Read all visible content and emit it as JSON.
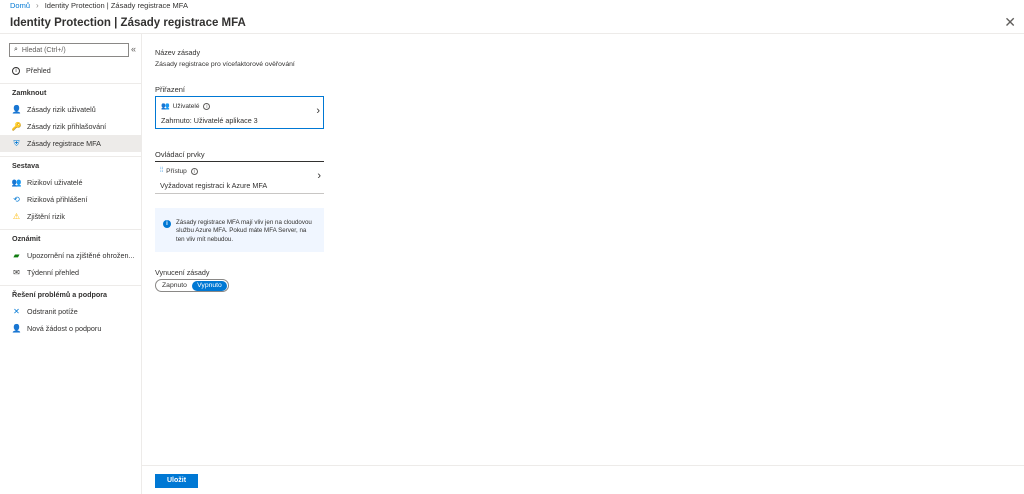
{
  "breadcrumb": {
    "home": "Domů",
    "current": "Identity Protection | Zásady registrace MFA"
  },
  "header": {
    "title": "Identity Protection | Zásady registrace MFA"
  },
  "sidebar": {
    "search_placeholder": "Hledat (Ctrl+/)",
    "overview": "Přehled",
    "sections": [
      {
        "title": "Zamknout",
        "items": [
          "Zásady rizik uživatelů",
          "Zásady rizik přihlašování",
          "Zásady registrace MFA"
        ]
      },
      {
        "title": "Sestava",
        "items": [
          "Rizikoví uživatelé",
          "Riziková přihlášení",
          "Zjištění rizik"
        ]
      },
      {
        "title": "Oznámit",
        "items": [
          "Upozornění na zjištěné ohrožen...",
          "Týdenní přehled"
        ]
      },
      {
        "title": "Řešení problémů a podpora",
        "items": [
          "Odstranit potíže",
          "Nová žádost o podporu"
        ]
      }
    ]
  },
  "main": {
    "policy_name_label": "Název zásady",
    "policy_name_value": "Zásady registrace pro vícefaktorové ověřování",
    "assignments_title": "Přiřazení",
    "users_label": "Uživatelé",
    "users_value": "Zahrnuto: Uživatelé aplikace 3",
    "controls_title": "Ovládací prvky",
    "access_label": "Přístup",
    "access_value": "Vyžadovat registraci k Azure MFA",
    "info_text": "Zásady registrace MFA mají vliv jen na cloudovou službu Azure MFA. Pokud máte MFA Server, na ten vliv mít nebudou.",
    "enforce_label": "Vynucení zásady",
    "toggle_on": "Zapnuto",
    "toggle_off": "Vypnuto",
    "toggle_selected": "Vypnuto"
  },
  "footer": {
    "save_label": "Uložit"
  },
  "colors": {
    "accent": "#0078d4",
    "selected_nav": "#edebe9"
  }
}
